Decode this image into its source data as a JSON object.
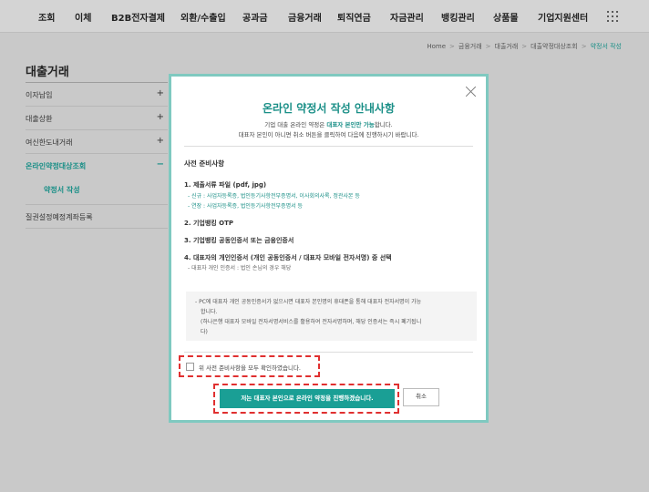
{
  "nav": {
    "items": [
      "조회",
      "이체",
      "B2B전자결제",
      "외환/수출입",
      "공과금",
      "금융거래",
      "퇴직연금",
      "자금관리",
      "뱅킹관리",
      "상품몰",
      "기업지원센터"
    ],
    "menu_icon": "grid-menu-icon"
  },
  "breadcrumb": {
    "items": [
      "Home",
      "금융거래",
      "대출거래",
      "대출약정대상조회",
      "약정서 작성"
    ],
    "separator": ">"
  },
  "sidebar": {
    "title": "대출거래",
    "items": [
      {
        "label": "이자납입",
        "sign": "+"
      },
      {
        "label": "대출상환",
        "sign": "+"
      },
      {
        "label": "여신한도내거래",
        "sign": "+"
      },
      {
        "label": "온라인약정대상조회",
        "sign": "−"
      }
    ],
    "sub_item": "약정서 작성",
    "last_item": "질권설정예정계좌등록"
  },
  "modal": {
    "title": "온라인 약정서 작성 안내사항",
    "desc_line1_pre": "기업 대출 온라인 약정은 ",
    "desc_line1_bold": "대표자 본인만 가능",
    "desc_line1_post": "합니다.",
    "desc_line2": "대표자 본인이 아니면 취소 버튼을 클릭하여 다음에 진행하시기 바랍니다.",
    "section_title": "사전 준비사항",
    "req1": "1. 제출서류 파일 (pdf, jpg)",
    "req1_sub1": "- 신규 : 사업자등록증, 법인등기사항전부증명서, 이사회의사록, 정관사본 등",
    "req1_sub2": "- 연장 : 사업자등록증, 법인등기사항전부증명서 등",
    "req2": "2. 기업뱅킹 OTP",
    "req3": "3. 기업뱅킹 공동인증서 또는 금융인증서",
    "req4": "4. 대표자의 개인인증서 (개인 공동인증서 / 대표자 모바일 전자서명) 중 선택",
    "req4_sub": "- 대표자 개인 인증서 : 법인 손님의 경우 해당",
    "notice_line1": "- PC에 대표자 개인 공동인증서가 없으시면 대표자 본인명의 휴대폰을 통해 대표자 전자서명이 가능",
    "notice_line2": "합니다.",
    "notice_line3": "(하나은행 대표자 모바일 전자서명서비스를 활용하여 전자서명하며, 해당 인증서는 즉시 폐기됩니",
    "notice_line4": "다)",
    "confirm_label": "위 사전 준비사항을 모두 확인하였습니다.",
    "primary_button": "저는 대표자 본인으로 온라인 약정을 진행하겠습니다.",
    "cancel_button": "취소"
  },
  "colors": {
    "accent": "#1a8f87",
    "button": "#1a9f95",
    "highlight_dash": "#e03030",
    "modal_border": "#7fc9c0"
  }
}
